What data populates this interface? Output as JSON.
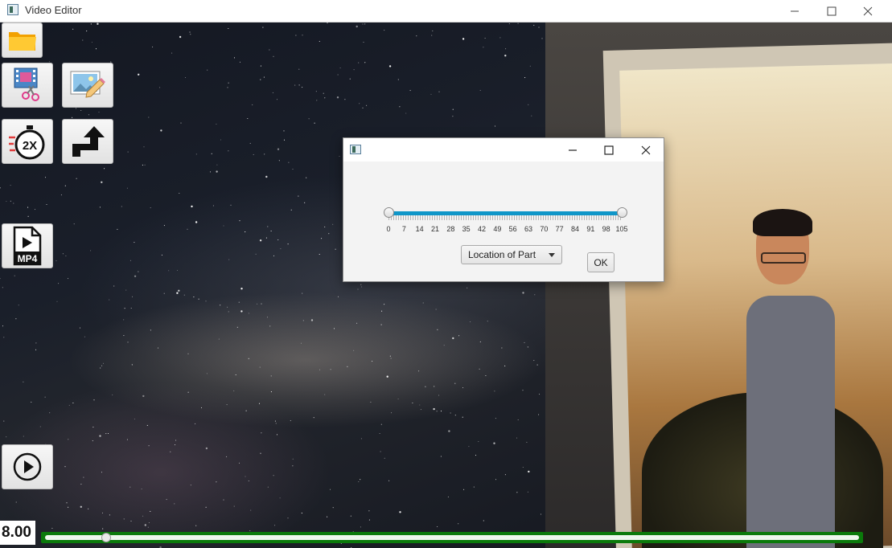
{
  "window": {
    "title": "Video Editor"
  },
  "toolbar": {
    "open_icon": "folder-icon",
    "cut_icon": "film-scissors-icon",
    "edit_image_icon": "image-pencil-icon",
    "speed_icon": "stopwatch-2x-icon",
    "speed_text": "2X",
    "swap_icon": "swap-arrows-icon",
    "export_icon": "mp4-file-icon",
    "export_text": "MP4",
    "play_icon": "play-icon"
  },
  "dialog": {
    "slider": {
      "min": 0,
      "max": 105,
      "low_value": 0,
      "high_value": 105,
      "ticks": [
        "0",
        "7",
        "14",
        "21",
        "28",
        "35",
        "42",
        "49",
        "56",
        "63",
        "70",
        "77",
        "84",
        "91",
        "98",
        "105"
      ]
    },
    "location_select": "Location of Part",
    "ok_label": "OK"
  },
  "timeline": {
    "time_value": "8.00",
    "progress_fraction": 0.075
  },
  "colors": {
    "slider_accent": "#0f96c8",
    "progress_border": "#0b7a0b"
  }
}
